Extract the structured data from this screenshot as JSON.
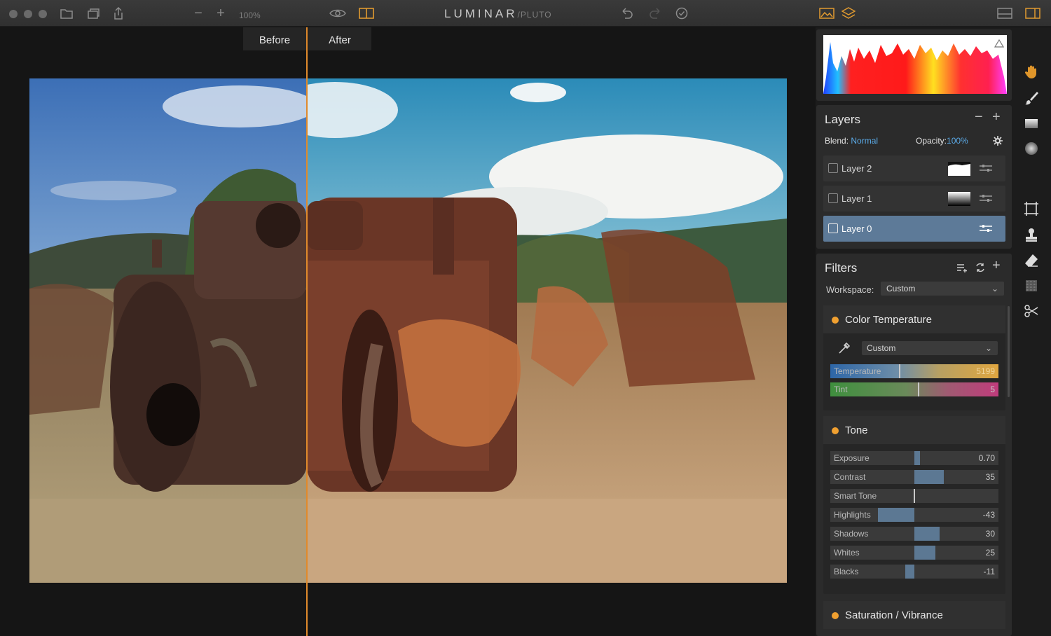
{
  "app": {
    "name": "LUMINAR",
    "edition": "/PLUTO"
  },
  "toolbar": {
    "zoom_minus": "−",
    "zoom_plus": "+",
    "zoom_level": "100%"
  },
  "compare": {
    "before_label": "Before",
    "after_label": "After"
  },
  "layers": {
    "title": "Layers",
    "blend_label": "Blend:",
    "blend_value": "Normal",
    "opacity_label": "Opacity:",
    "opacity_value": "100%",
    "items": [
      {
        "name": "Layer 2"
      },
      {
        "name": "Layer 1"
      },
      {
        "name": "Layer 0"
      }
    ]
  },
  "filters": {
    "title": "Filters",
    "workspace_label": "Workspace:",
    "workspace_value": "Custom",
    "color_temperature": {
      "title": "Color Temperature",
      "preset": "Custom",
      "sliders": [
        {
          "label": "Temperature",
          "value": "5199",
          "level": 0.41
        },
        {
          "label": "Tint",
          "value": "5",
          "level": 0.52
        }
      ]
    },
    "tone": {
      "title": "Tone",
      "sliders": [
        {
          "label": "Exposure",
          "value": "0.70",
          "level": 0.07
        },
        {
          "label": "Contrast",
          "value": "35",
          "level": 0.35
        },
        {
          "label": "Smart Tone",
          "value": "",
          "level": 0.0
        },
        {
          "label": "Highlights",
          "value": "-43",
          "level": -0.43
        },
        {
          "label": "Shadows",
          "value": "30",
          "level": 0.3
        },
        {
          "label": "Whites",
          "value": "25",
          "level": 0.25
        },
        {
          "label": "Blacks",
          "value": "-11",
          "level": -0.11
        }
      ]
    },
    "saturation": {
      "title": "Saturation / Vibrance"
    }
  },
  "colors": {
    "accent_orange": "#e08a2c",
    "accent_blue": "#5aa9e6",
    "slider_fill": "#5c7893",
    "active_layer": "#5d7a98"
  },
  "icons": {
    "toolbar": [
      "folder-icon",
      "layers-stack-icon",
      "share-icon",
      "eye-icon",
      "split-view-icon",
      "undo-icon",
      "redo-icon",
      "history-icon",
      "image-icon",
      "layers-icon",
      "panel-toggle-icon",
      "sidebar-icon"
    ],
    "tools": [
      "hand-icon",
      "brush-icon",
      "gradient-icon",
      "radial-icon",
      "crop-icon",
      "stamp-icon",
      "eraser-icon",
      "noise-icon",
      "scissors-icon"
    ]
  }
}
